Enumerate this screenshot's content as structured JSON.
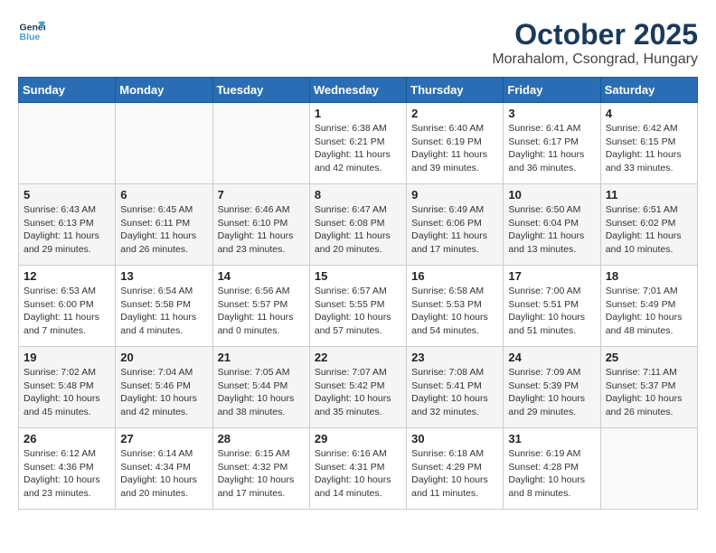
{
  "header": {
    "logo_line1": "General",
    "logo_line2": "Blue",
    "title": "October 2025",
    "subtitle": "Morahalom, Csongrad, Hungary"
  },
  "weekdays": [
    "Sunday",
    "Monday",
    "Tuesday",
    "Wednesday",
    "Thursday",
    "Friday",
    "Saturday"
  ],
  "weeks": [
    [
      {
        "day": "",
        "info": ""
      },
      {
        "day": "",
        "info": ""
      },
      {
        "day": "",
        "info": ""
      },
      {
        "day": "1",
        "info": "Sunrise: 6:38 AM\nSunset: 6:21 PM\nDaylight: 11 hours\nand 42 minutes."
      },
      {
        "day": "2",
        "info": "Sunrise: 6:40 AM\nSunset: 6:19 PM\nDaylight: 11 hours\nand 39 minutes."
      },
      {
        "day": "3",
        "info": "Sunrise: 6:41 AM\nSunset: 6:17 PM\nDaylight: 11 hours\nand 36 minutes."
      },
      {
        "day": "4",
        "info": "Sunrise: 6:42 AM\nSunset: 6:15 PM\nDaylight: 11 hours\nand 33 minutes."
      }
    ],
    [
      {
        "day": "5",
        "info": "Sunrise: 6:43 AM\nSunset: 6:13 PM\nDaylight: 11 hours\nand 29 minutes."
      },
      {
        "day": "6",
        "info": "Sunrise: 6:45 AM\nSunset: 6:11 PM\nDaylight: 11 hours\nand 26 minutes."
      },
      {
        "day": "7",
        "info": "Sunrise: 6:46 AM\nSunset: 6:10 PM\nDaylight: 11 hours\nand 23 minutes."
      },
      {
        "day": "8",
        "info": "Sunrise: 6:47 AM\nSunset: 6:08 PM\nDaylight: 11 hours\nand 20 minutes."
      },
      {
        "day": "9",
        "info": "Sunrise: 6:49 AM\nSunset: 6:06 PM\nDaylight: 11 hours\nand 17 minutes."
      },
      {
        "day": "10",
        "info": "Sunrise: 6:50 AM\nSunset: 6:04 PM\nDaylight: 11 hours\nand 13 minutes."
      },
      {
        "day": "11",
        "info": "Sunrise: 6:51 AM\nSunset: 6:02 PM\nDaylight: 11 hours\nand 10 minutes."
      }
    ],
    [
      {
        "day": "12",
        "info": "Sunrise: 6:53 AM\nSunset: 6:00 PM\nDaylight: 11 hours\nand 7 minutes."
      },
      {
        "day": "13",
        "info": "Sunrise: 6:54 AM\nSunset: 5:58 PM\nDaylight: 11 hours\nand 4 minutes."
      },
      {
        "day": "14",
        "info": "Sunrise: 6:56 AM\nSunset: 5:57 PM\nDaylight: 11 hours\nand 0 minutes."
      },
      {
        "day": "15",
        "info": "Sunrise: 6:57 AM\nSunset: 5:55 PM\nDaylight: 10 hours\nand 57 minutes."
      },
      {
        "day": "16",
        "info": "Sunrise: 6:58 AM\nSunset: 5:53 PM\nDaylight: 10 hours\nand 54 minutes."
      },
      {
        "day": "17",
        "info": "Sunrise: 7:00 AM\nSunset: 5:51 PM\nDaylight: 10 hours\nand 51 minutes."
      },
      {
        "day": "18",
        "info": "Sunrise: 7:01 AM\nSunset: 5:49 PM\nDaylight: 10 hours\nand 48 minutes."
      }
    ],
    [
      {
        "day": "19",
        "info": "Sunrise: 7:02 AM\nSunset: 5:48 PM\nDaylight: 10 hours\nand 45 minutes."
      },
      {
        "day": "20",
        "info": "Sunrise: 7:04 AM\nSunset: 5:46 PM\nDaylight: 10 hours\nand 42 minutes."
      },
      {
        "day": "21",
        "info": "Sunrise: 7:05 AM\nSunset: 5:44 PM\nDaylight: 10 hours\nand 38 minutes."
      },
      {
        "day": "22",
        "info": "Sunrise: 7:07 AM\nSunset: 5:42 PM\nDaylight: 10 hours\nand 35 minutes."
      },
      {
        "day": "23",
        "info": "Sunrise: 7:08 AM\nSunset: 5:41 PM\nDaylight: 10 hours\nand 32 minutes."
      },
      {
        "day": "24",
        "info": "Sunrise: 7:09 AM\nSunset: 5:39 PM\nDaylight: 10 hours\nand 29 minutes."
      },
      {
        "day": "25",
        "info": "Sunrise: 7:11 AM\nSunset: 5:37 PM\nDaylight: 10 hours\nand 26 minutes."
      }
    ],
    [
      {
        "day": "26",
        "info": "Sunrise: 6:12 AM\nSunset: 4:36 PM\nDaylight: 10 hours\nand 23 minutes."
      },
      {
        "day": "27",
        "info": "Sunrise: 6:14 AM\nSunset: 4:34 PM\nDaylight: 10 hours\nand 20 minutes."
      },
      {
        "day": "28",
        "info": "Sunrise: 6:15 AM\nSunset: 4:32 PM\nDaylight: 10 hours\nand 17 minutes."
      },
      {
        "day": "29",
        "info": "Sunrise: 6:16 AM\nSunset: 4:31 PM\nDaylight: 10 hours\nand 14 minutes."
      },
      {
        "day": "30",
        "info": "Sunrise: 6:18 AM\nSunset: 4:29 PM\nDaylight: 10 hours\nand 11 minutes."
      },
      {
        "day": "31",
        "info": "Sunrise: 6:19 AM\nSunset: 4:28 PM\nDaylight: 10 hours\nand 8 minutes."
      },
      {
        "day": "",
        "info": ""
      }
    ]
  ]
}
